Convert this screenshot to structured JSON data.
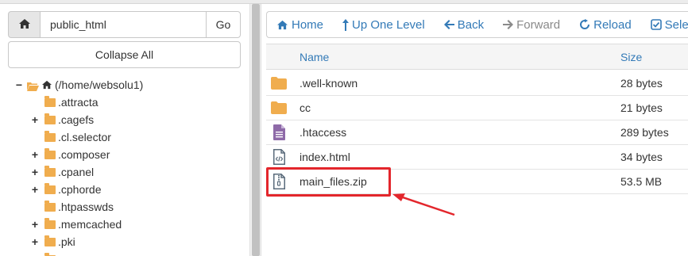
{
  "left": {
    "path_value": "public_html",
    "go_label": "Go",
    "collapse_label": "Collapse All",
    "tree": {
      "root_label": "(/home/websolu1)",
      "items": [
        {
          "label": ".attracta",
          "expandable": false
        },
        {
          "label": ".cagefs",
          "expandable": true
        },
        {
          "label": ".cl.selector",
          "expandable": false
        },
        {
          "label": ".composer",
          "expandable": true
        },
        {
          "label": ".cpanel",
          "expandable": true
        },
        {
          "label": ".cphorde",
          "expandable": true
        },
        {
          "label": ".htpasswds",
          "expandable": false
        },
        {
          "label": ".memcached",
          "expandable": true
        },
        {
          "label": ".pki",
          "expandable": true
        }
      ]
    }
  },
  "toolbar": {
    "home_label": "Home",
    "up_label": "Up One Level",
    "back_label": "Back",
    "forward_label": "Forward",
    "reload_label": "Reload",
    "select_label": "Select"
  },
  "table": {
    "col_name": "Name",
    "col_size": "Size",
    "rows": [
      {
        "name": ".well-known",
        "size": "28 bytes",
        "icon": "folder-icon"
      },
      {
        "name": "cc",
        "size": "21 bytes",
        "icon": "folder-icon"
      },
      {
        "name": ".htaccess",
        "size": "289 bytes",
        "icon": "text-file-icon"
      },
      {
        "name": "index.html",
        "size": "34 bytes",
        "icon": "code-file-icon"
      },
      {
        "name": "main_files.zip",
        "size": "53.5 MB",
        "icon": "zip-file-icon"
      }
    ]
  },
  "colors": {
    "link": "#337ab7",
    "folder": "#f0ad4e",
    "annotation": "#e3262c"
  }
}
